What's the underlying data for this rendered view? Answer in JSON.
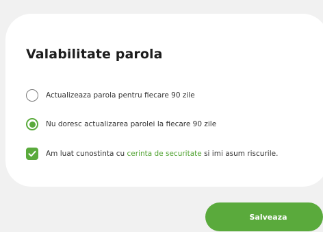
{
  "dialog": {
    "title": "Valabilitate parola",
    "options": [
      {
        "label": "Actualizeaza parola pentru fiecare 90 zile",
        "selected": false
      },
      {
        "label": "Nu doresc actualizarea parolei la fiecare 90 zile",
        "selected": true
      }
    ],
    "consent": {
      "checked": true,
      "text_before": "Am luat cunostinta cu ",
      "link_text": "cerinta de securitate",
      "text_after": " si imi asum riscurile."
    }
  },
  "actions": {
    "save_label": "Salveaza"
  },
  "colors": {
    "accent": "#5aaa3c",
    "background": "#f1f1f1",
    "card": "#ffffff",
    "text": "#333333",
    "title": "#1d1d1d"
  }
}
